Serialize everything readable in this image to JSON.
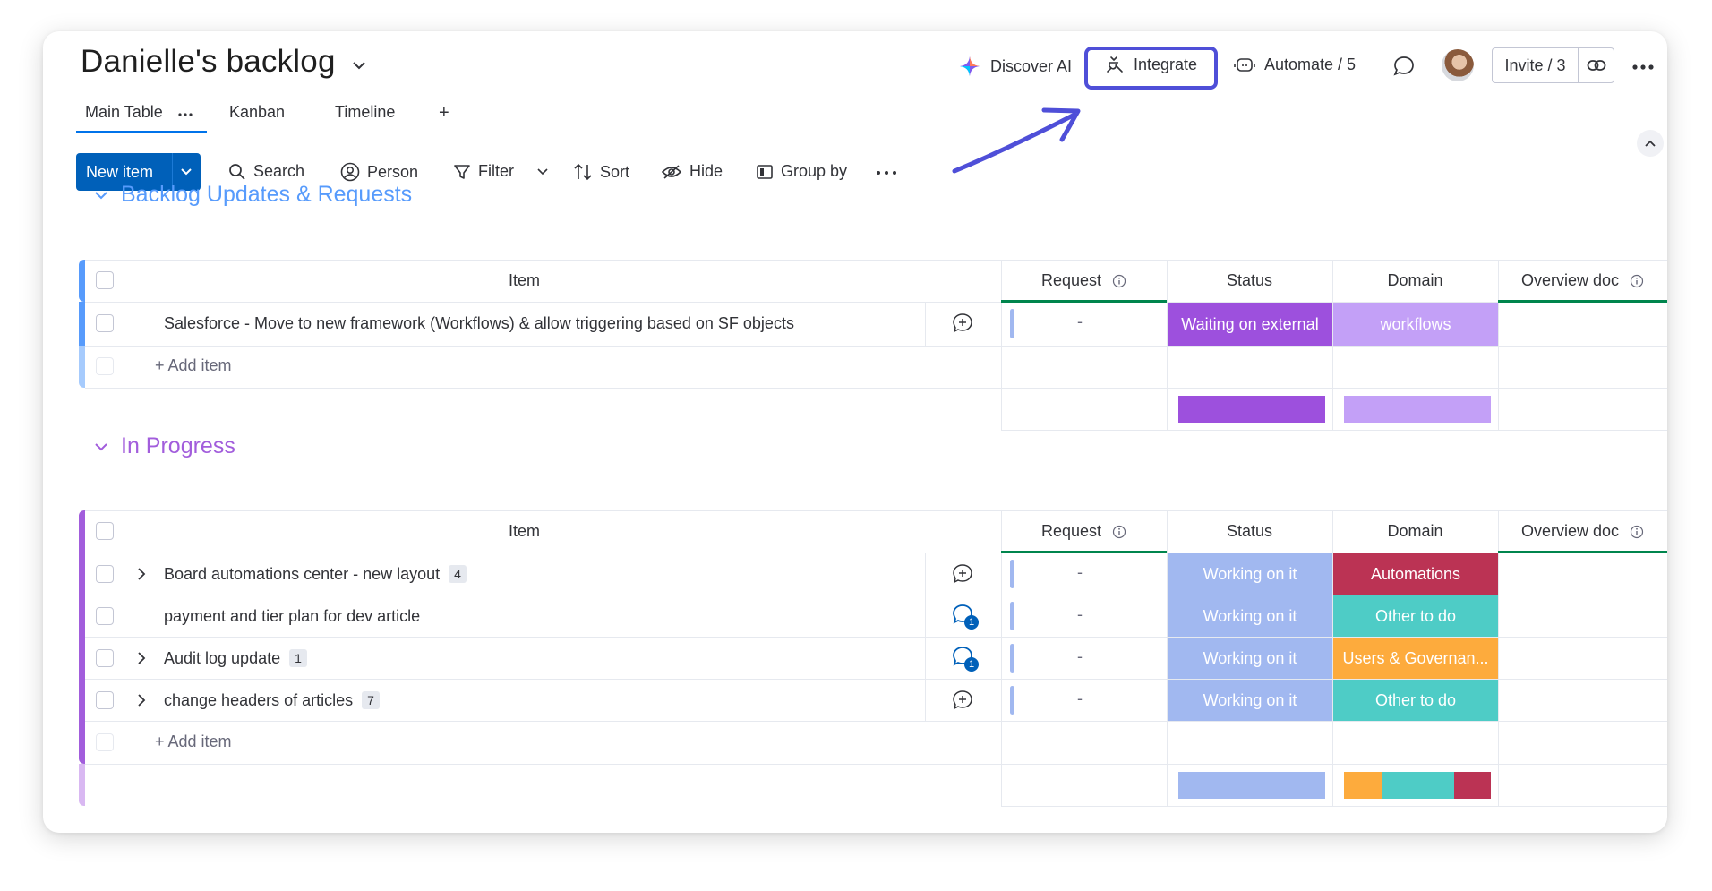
{
  "header": {
    "title": "Danielle's backlog",
    "tabs": [
      "Main Table",
      "Kanban",
      "Timeline"
    ],
    "add_tab": "+",
    "discover_ai": "Discover AI",
    "integrate": "Integrate",
    "automate": "Automate / 5",
    "invite": "Invite / 3"
  },
  "toolbar": {
    "new_item": "New item",
    "search": "Search",
    "person": "Person",
    "filter": "Filter",
    "sort": "Sort",
    "hide": "Hide",
    "group_by": "Group by"
  },
  "columns": {
    "item": "Item",
    "request": "Request",
    "status": "Status",
    "domain": "Domain",
    "overview_doc": "Overview doc"
  },
  "groups": [
    {
      "name": "Backlog Updates & Requests",
      "color": "#579bfc",
      "rows": [
        {
          "item": "Salesforce - Move to new framework (Workflows) & allow triggering based on SF objects",
          "subitems": "",
          "request": "-",
          "status": "Waiting on external",
          "status_color": "#9d50dd",
          "domain": "workflows",
          "domain_color": "#c3a0f7"
        }
      ],
      "add_item": "+ Add item",
      "summary_colors": [
        "#9d50dd",
        "#c3a0f7"
      ]
    },
    {
      "name": "In Progress",
      "color": "#a25ddc",
      "rows": [
        {
          "item": "Board automations center - new layout",
          "subitems": "4",
          "request": "-",
          "status": "Working on it",
          "status_color": "#a1b8f0",
          "domain": "Automations",
          "domain_color": "#bb3354"
        },
        {
          "item": "payment and tier plan for dev article",
          "subitems": "",
          "updates": "1",
          "request": "-",
          "status": "Working on it",
          "status_color": "#a1b8f0",
          "domain": "Other to do",
          "domain_color": "#4eccc6"
        },
        {
          "item": "Audit log update",
          "subitems": "1",
          "updates": "1",
          "request": "-",
          "status": "Working on it",
          "status_color": "#a1b8f0",
          "domain": "Users & Governan...",
          "domain_color": "#fdab3d"
        },
        {
          "item": "change headers of articles",
          "subitems": "7",
          "request": "-",
          "status": "Working on it",
          "status_color": "#a1b8f0",
          "domain": "Other to do",
          "domain_color": "#4eccc6"
        }
      ],
      "add_item": "+ Add item",
      "summary_colors": [
        "#a1b8f0",
        "#fdab3d",
        "#4eccc6",
        "#bb3354"
      ]
    }
  ],
  "colors": {
    "primary": "#0060b9",
    "highlight": "#4f4fd8",
    "group1": "#579bfc",
    "group2": "#a25ddc"
  }
}
